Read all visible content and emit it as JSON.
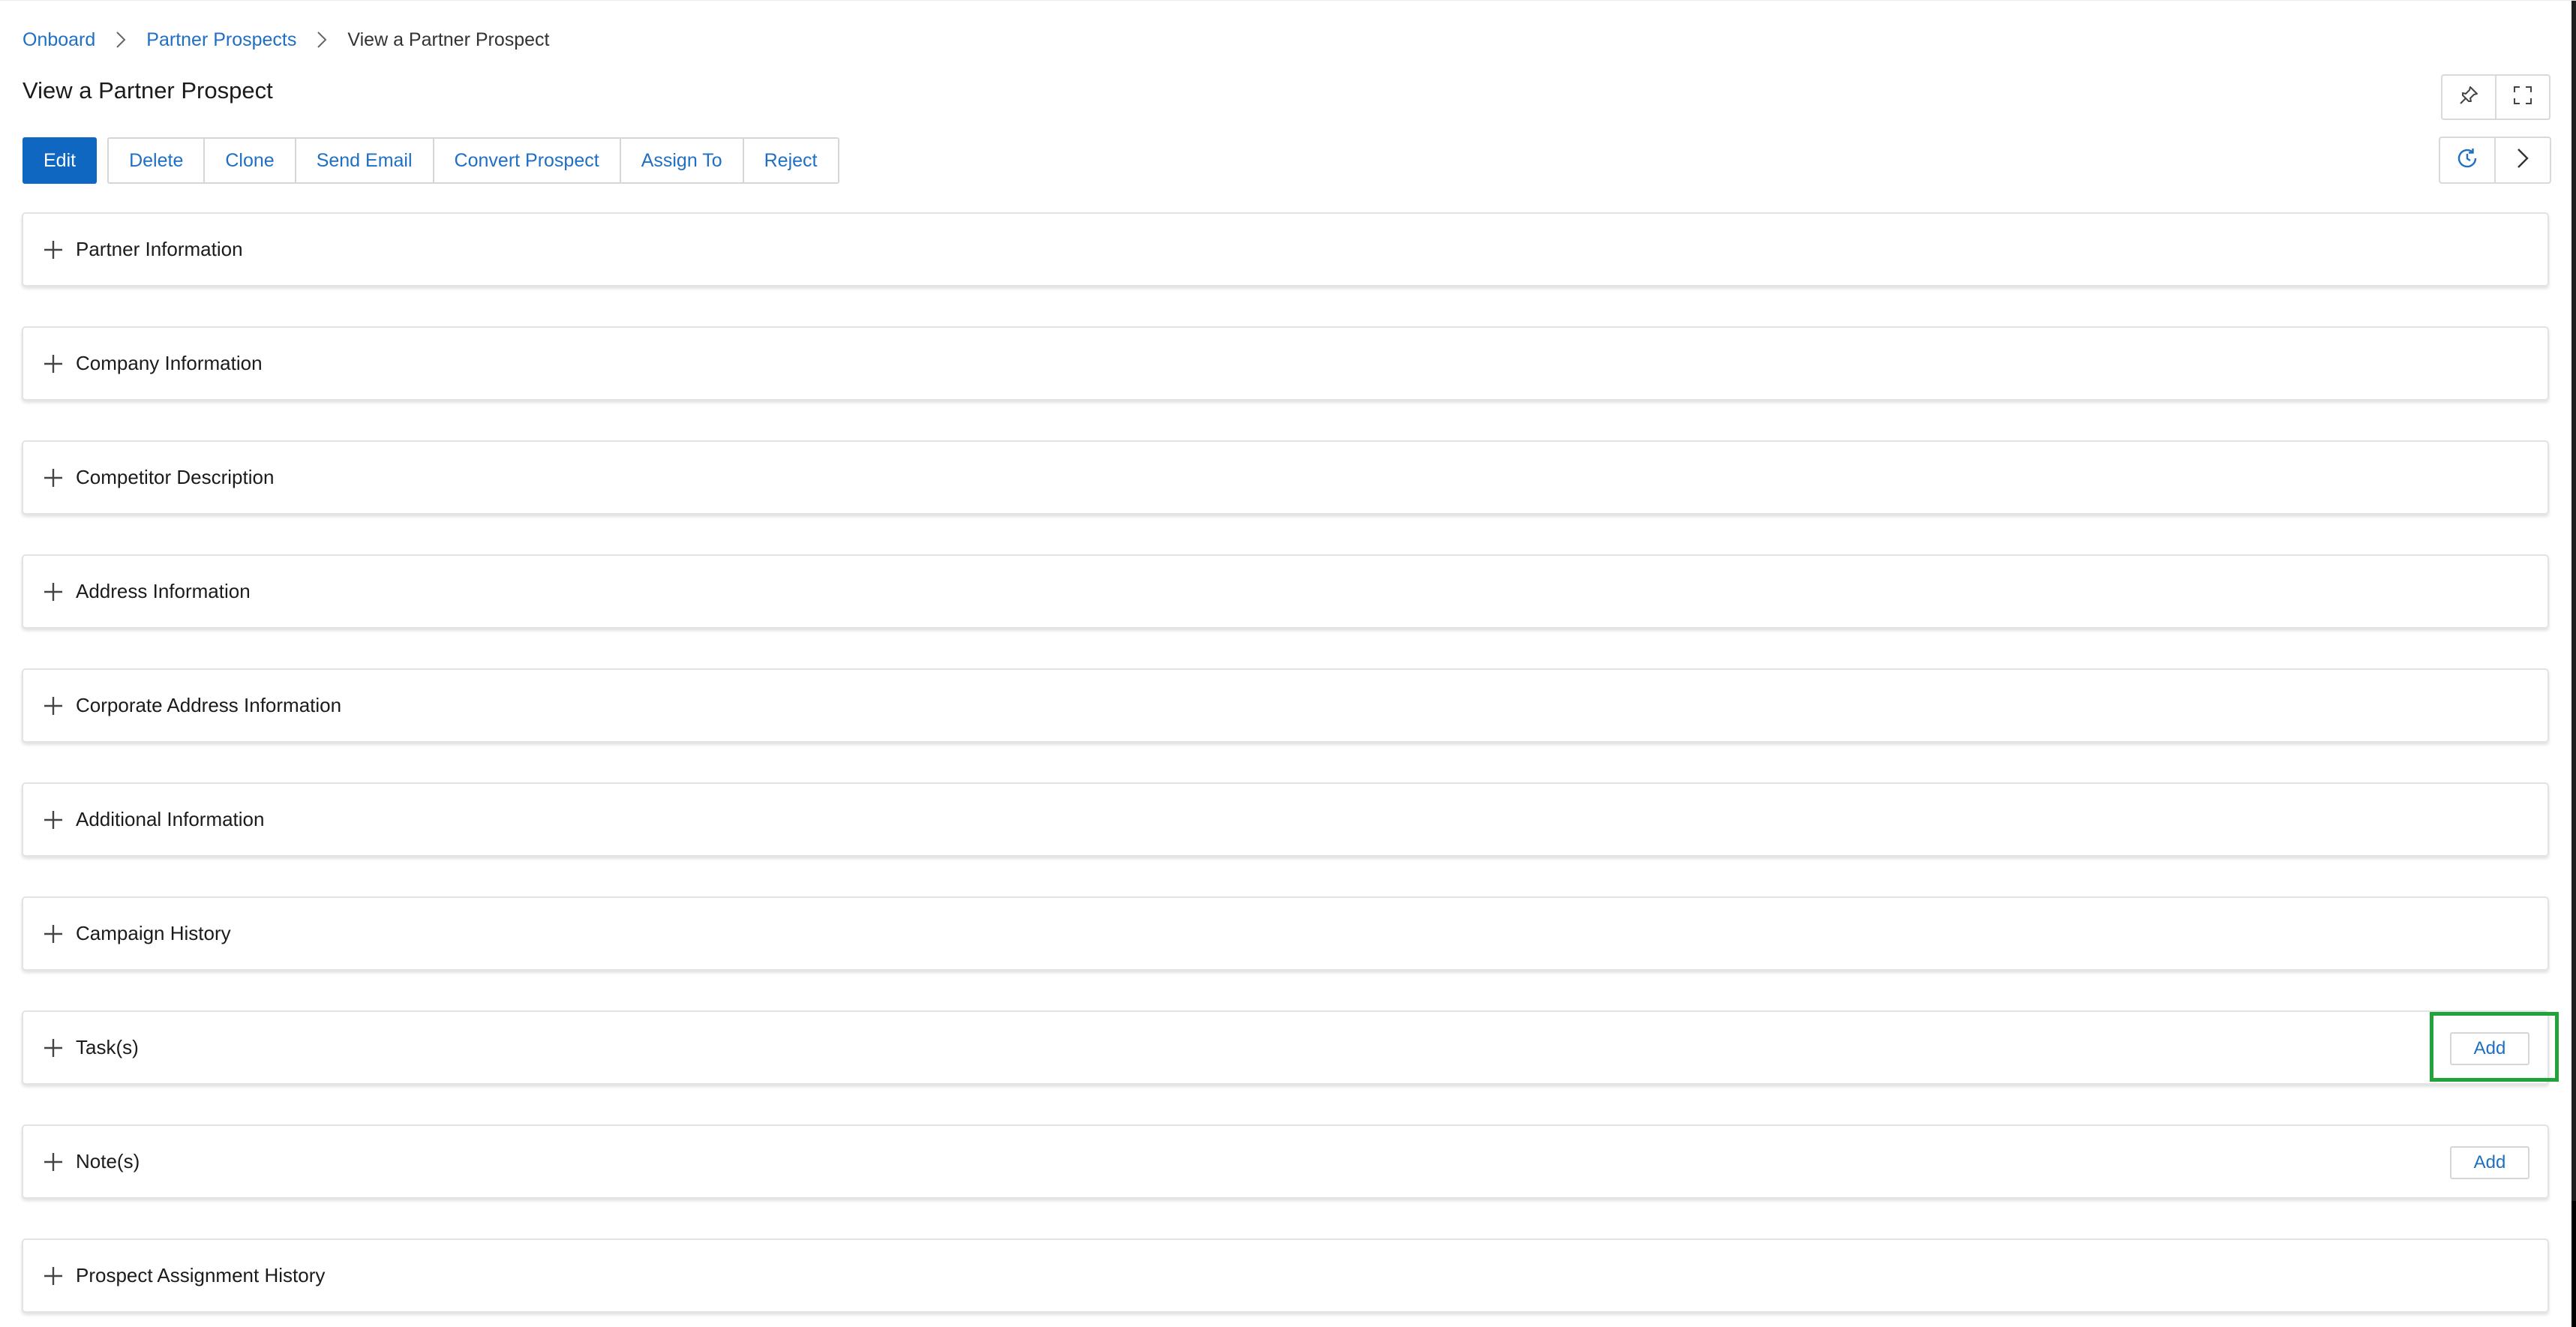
{
  "breadcrumb": {
    "items": [
      "Onboard",
      "Partner Prospects"
    ],
    "current": "View a Partner Prospect"
  },
  "page_title": "View a Partner Prospect",
  "header_icons": [
    "pin-icon",
    "fullscreen-icon"
  ],
  "toolbar": {
    "primary_label": "Edit",
    "actions": [
      "Delete",
      "Clone",
      "Send Email",
      "Convert Prospect",
      "Assign To",
      "Reject"
    ],
    "right_icons": [
      "history-icon",
      "chevron-right-icon"
    ]
  },
  "sections": [
    {
      "label": "Partner Information"
    },
    {
      "label": "Company Information"
    },
    {
      "label": "Competitor Description"
    },
    {
      "label": "Address Information"
    },
    {
      "label": "Corporate Address Information"
    },
    {
      "label": "Additional Information"
    },
    {
      "label": "Campaign History"
    },
    {
      "label": "Task(s)",
      "action": "Add"
    },
    {
      "label": "Note(s)",
      "action": "Add"
    },
    {
      "label": "Prospect Assignment History"
    }
  ],
  "colors": {
    "primary": "#0f67c2",
    "link": "#1f6fc5",
    "highlight": "#1fa33a"
  }
}
